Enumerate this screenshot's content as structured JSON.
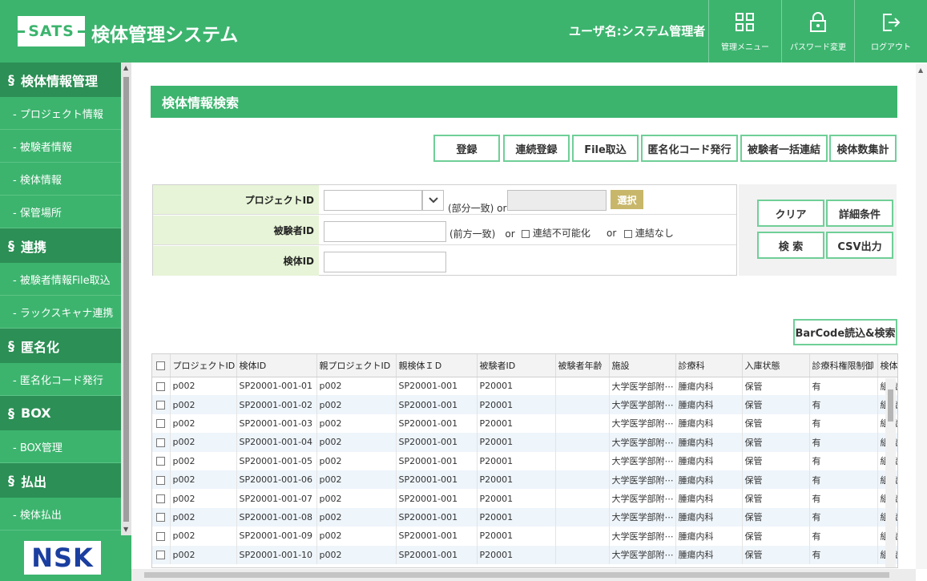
{
  "header": {
    "logo_text": "SATS",
    "app_title": "検体管理システム",
    "username": "ユーザ名:システム管理者",
    "buttons": [
      {
        "label": "管理メニュー",
        "icon": "grid-icon"
      },
      {
        "label": "パスワード変更",
        "icon": "lock-icon"
      },
      {
        "label": "ログアウト",
        "icon": "logout-icon"
      }
    ]
  },
  "sidebar": {
    "sections": [
      {
        "title": "検体情報管理",
        "items": [
          "- プロジェクト情報",
          "- 被験者情報",
          "- 検体情報",
          "- 保管場所"
        ]
      },
      {
        "title": "連携",
        "items": [
          "- 被験者情報File取込",
          "- ラックスキャナ連携"
        ]
      },
      {
        "title": "匿名化",
        "items": [
          "- 匿名化コード発行"
        ]
      },
      {
        "title": "BOX",
        "items": [
          "- BOX管理"
        ]
      },
      {
        "title": "払出",
        "items": [
          "- 検体払出"
        ]
      }
    ],
    "section_mark": "§",
    "brand": "NSK"
  },
  "main": {
    "page_title": "検体情報検索",
    "action_buttons": [
      "登録",
      "連続登録",
      "File取込",
      "匿名化コード発行",
      "被験者一括連結",
      "検体数集計"
    ],
    "form": {
      "project_label": "プロジェクトID",
      "project_hint": "(部分一致) or",
      "select_label": "選択",
      "subject_label": "被験者ID",
      "subject_hint": "(前方一致)　or",
      "unlinkable_label": "連結不可能化",
      "or_text": "or",
      "nolink_label": "連結なし",
      "sample_label": "検体ID"
    },
    "side_buttons": [
      "クリア",
      "詳細条件",
      "検 索",
      "CSV出力"
    ],
    "barcode_button": "BarCode読込&検索",
    "table": {
      "columns": [
        "プロジェクトID",
        "検体ID",
        "親プロジェクトID",
        "親検体ＩＤ",
        "被験者ID",
        "被験者年齢",
        "施設",
        "診療科",
        "入庫状態",
        "診療科権限制御",
        "検体種"
      ],
      "rows": [
        [
          "p002",
          "SP20001-001-01",
          "p002",
          "SP20001-001",
          "P20001",
          "",
          "大学医学部附⋯",
          "腫瘍内科",
          "保管",
          "有",
          "組織"
        ],
        [
          "p002",
          "SP20001-001-02",
          "p002",
          "SP20001-001",
          "P20001",
          "",
          "大学医学部附⋯",
          "腫瘍内科",
          "保管",
          "有",
          "組織"
        ],
        [
          "p002",
          "SP20001-001-03",
          "p002",
          "SP20001-001",
          "P20001",
          "",
          "大学医学部附⋯",
          "腫瘍内科",
          "保管",
          "有",
          "組織"
        ],
        [
          "p002",
          "SP20001-001-04",
          "p002",
          "SP20001-001",
          "P20001",
          "",
          "大学医学部附⋯",
          "腫瘍内科",
          "保管",
          "有",
          "組織"
        ],
        [
          "p002",
          "SP20001-001-05",
          "p002",
          "SP20001-001",
          "P20001",
          "",
          "大学医学部附⋯",
          "腫瘍内科",
          "保管",
          "有",
          "組織"
        ],
        [
          "p002",
          "SP20001-001-06",
          "p002",
          "SP20001-001",
          "P20001",
          "",
          "大学医学部附⋯",
          "腫瘍内科",
          "保管",
          "有",
          "組織"
        ],
        [
          "p002",
          "SP20001-001-07",
          "p002",
          "SP20001-001",
          "P20001",
          "",
          "大学医学部附⋯",
          "腫瘍内科",
          "保管",
          "有",
          "組織"
        ],
        [
          "p002",
          "SP20001-001-08",
          "p002",
          "SP20001-001",
          "P20001",
          "",
          "大学医学部附⋯",
          "腫瘍内科",
          "保管",
          "有",
          "組織"
        ],
        [
          "p002",
          "SP20001-001-09",
          "p002",
          "SP20001-001",
          "P20001",
          "",
          "大学医学部附⋯",
          "腫瘍内科",
          "保管",
          "有",
          "組織"
        ],
        [
          "p002",
          "SP20001-001-10",
          "p002",
          "SP20001-001",
          "P20001",
          "",
          "大学医学部附⋯",
          "腫瘍内科",
          "保管",
          "有",
          "組織"
        ]
      ]
    }
  },
  "colors": {
    "brand_green": "#3cb46e",
    "dark_green": "#2c8f55",
    "label_bg": "#e7f4d7",
    "select_gold": "#c8b76a",
    "nsk_blue": "#1b3fa0"
  }
}
